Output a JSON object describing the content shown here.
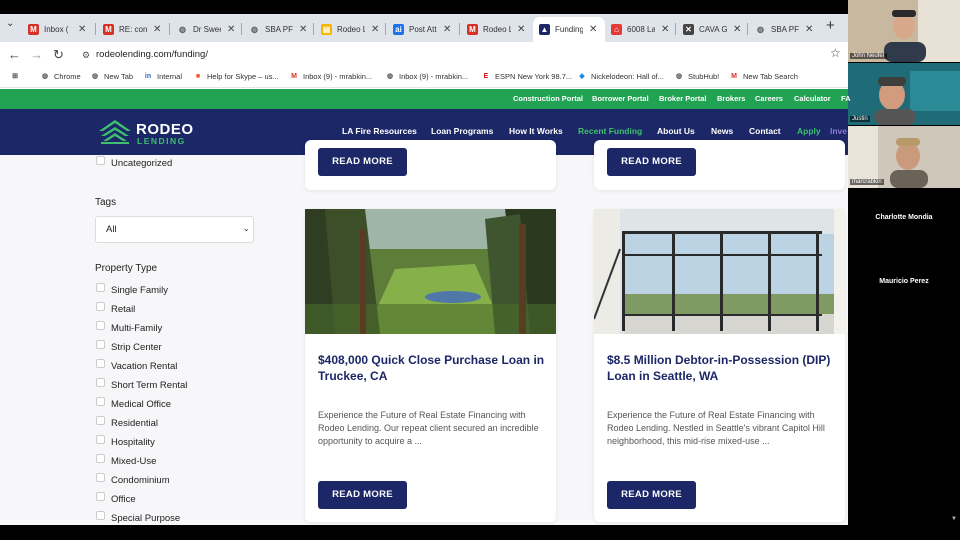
{
  "browser": {
    "tabs": [
      {
        "title": "Inbox (",
        "icon": "gmail-icon",
        "color": "#d93025",
        "glyph": "M"
      },
      {
        "title": "RE: con",
        "icon": "gmail-icon",
        "color": "#d93025",
        "glyph": "M"
      },
      {
        "title": "Dr Swee",
        "icon": "globe-icon",
        "color": "#5f6368",
        "glyph": "◍"
      },
      {
        "title": "SBA PFS",
        "icon": "globe-icon",
        "color": "#5f6368",
        "glyph": "◍"
      },
      {
        "title": "Rodeo L",
        "icon": "doc-icon",
        "color": "#f4b400",
        "glyph": "▤"
      },
      {
        "title": "Post Att",
        "icon": "pdf-icon",
        "color": "#1a73e8",
        "glyph": "ai"
      },
      {
        "title": "Rodeo L",
        "icon": "gmail-icon",
        "color": "#d93025",
        "glyph": "M"
      },
      {
        "title": "Funding",
        "icon": "rodeo-icon",
        "color": "#1b2766",
        "glyph": "▲"
      },
      {
        "title": "6008 La",
        "icon": "home-icon",
        "color": "#e53935",
        "glyph": "⌂"
      },
      {
        "title": "CAVA G",
        "icon": "cava-icon",
        "color": "#444444",
        "glyph": "✕"
      },
      {
        "title": "SBA PFS",
        "icon": "globe-icon",
        "color": "#5f6368",
        "glyph": "◍"
      }
    ],
    "url": "rodeolending.com/funding/",
    "bookmarks": [
      {
        "label": "Apps",
        "icon": "apps-grid-icon",
        "color": "#444",
        "glyph": "⊞"
      },
      {
        "label": "Chrome",
        "icon": "globe-icon",
        "color": "#555",
        "glyph": "◍"
      },
      {
        "label": "New Tab",
        "icon": "globe-icon",
        "color": "#555",
        "glyph": "◍"
      },
      {
        "label": "Internal",
        "icon": "internal-icon",
        "color": "#2b6cb0",
        "glyph": "in"
      },
      {
        "label": "Help for Skype – us...",
        "icon": "microsoft-icon",
        "color": "#f25022",
        "glyph": "■"
      },
      {
        "label": "Inbox (9) - mrabkin...",
        "icon": "gmail-icon",
        "color": "#d93025",
        "glyph": "M"
      },
      {
        "label": "Inbox (9) - mrabkin...",
        "icon": "globe-icon",
        "color": "#555",
        "glyph": "◍"
      },
      {
        "label": "ESPN New York 98.7...",
        "icon": "espn-icon",
        "color": "#d50a0a",
        "glyph": "E"
      },
      {
        "label": "Nickelodeon: Hall of...",
        "icon": "nick-icon",
        "color": "#1e88e5",
        "glyph": "◆"
      },
      {
        "label": "StubHub!",
        "icon": "globe-icon",
        "color": "#555",
        "glyph": "◍"
      },
      {
        "label": "New Tab Search",
        "icon": "gmail-icon",
        "color": "#d93025",
        "glyph": "M"
      }
    ]
  },
  "site": {
    "utility_links": [
      "Construction Portal",
      "Borrower Portal",
      "Broker Portal",
      "Brokers",
      "Careers",
      "Calculator",
      "FA"
    ],
    "logo": {
      "name": "RODEO",
      "sub": "LENDING"
    },
    "nav": [
      "LA Fire Resources",
      "Loan Programs",
      "How It Works",
      "Recent Funding",
      "About Us",
      "News",
      "Contact",
      "Apply",
      "Inve"
    ],
    "nav_active": "Recent Funding",
    "colors": {
      "navy": "#1b2766",
      "green": "#21a353",
      "accent": "#3fbf6f",
      "apply": "#3fbf6f"
    }
  },
  "sidebar": {
    "category_uncategorized": "Uncategorized",
    "tags_heading": "Tags",
    "tags_value": "All",
    "property_type_heading": "Property Type",
    "property_types": [
      "Single Family",
      "Retail",
      "Multi-Family",
      "Strip Center",
      "Vacation Rental",
      "Short Term Rental",
      "Medical Office",
      "Residential",
      "Hospitality",
      "Mixed-Use",
      "Condominium",
      "Office",
      "Special Purpose"
    ]
  },
  "cards": {
    "read_more": "READ MORE",
    "posts": [
      {
        "title": "$408,000 Quick Close Purchase Loan in Truckee, CA",
        "excerpt": "Experience the Future of Real Estate Financing with Rodeo Lending. Our repeat client secured an incredible opportunity to acquire a ..."
      },
      {
        "title": "$8.5 Million Debtor-in-Possession (DIP) Loan in Seattle, WA",
        "excerpt": "Experience the Future of Real Estate Financing with Rodeo Lending. Nestled in Seattle's vibrant Capitol Hill neighborhood, this mid-rise mixed-use ..."
      }
    ]
  },
  "meeting": {
    "participants": [
      "John Neufer",
      "Justin",
      "marcrabkin"
    ],
    "name_tiles": [
      "Charlotte Mondia",
      "Mauricio Perez"
    ]
  }
}
